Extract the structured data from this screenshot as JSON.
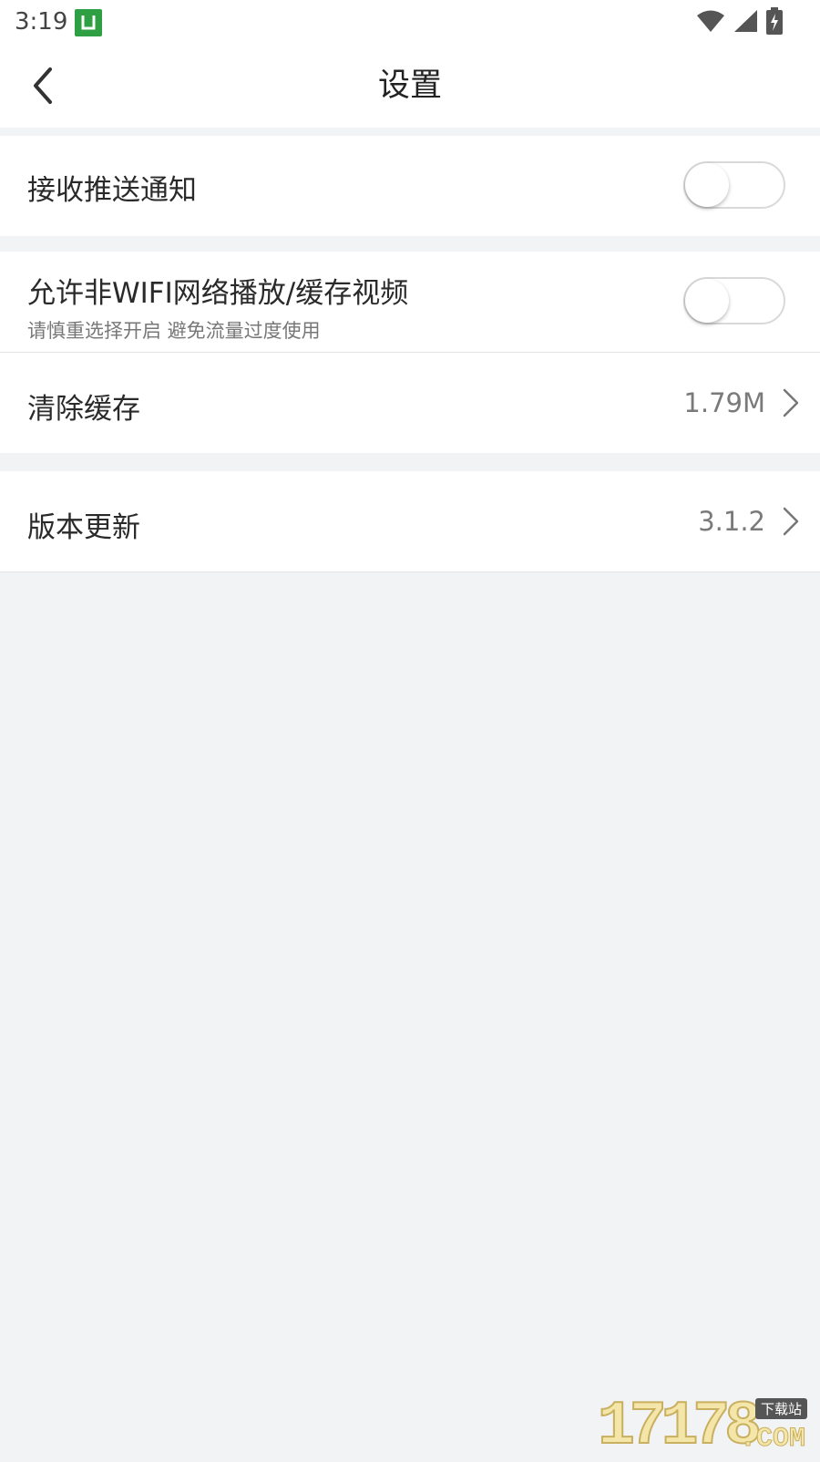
{
  "status_bar": {
    "time": "3:19",
    "app_icon": "app-notification-icon",
    "wifi_icon": "wifi-icon",
    "signal_icon": "cell-signal-icon",
    "battery_icon": "battery-charging-icon"
  },
  "nav": {
    "back_icon": "chevron-left-icon",
    "title": "设置"
  },
  "settings": {
    "push_notifications": {
      "label": "接收推送通知",
      "enabled": false
    },
    "non_wifi_playback": {
      "label": "允许非WIFI网络播放/缓存视频",
      "sublabel": "请慎重选择开启 避免流量过度使用",
      "enabled": false
    },
    "clear_cache": {
      "label": "清除缓存",
      "value": "1.79M"
    },
    "version_update": {
      "label": "版本更新",
      "value": "3.1.2"
    }
  },
  "watermark": {
    "main": "17178",
    "tag": "下载站",
    "suffix": ".COM"
  },
  "colors": {
    "background": "#f2f3f5",
    "surface": "#ffffff",
    "app_icon_green": "#2ea043",
    "toggle_border": "#d9d9d9"
  }
}
